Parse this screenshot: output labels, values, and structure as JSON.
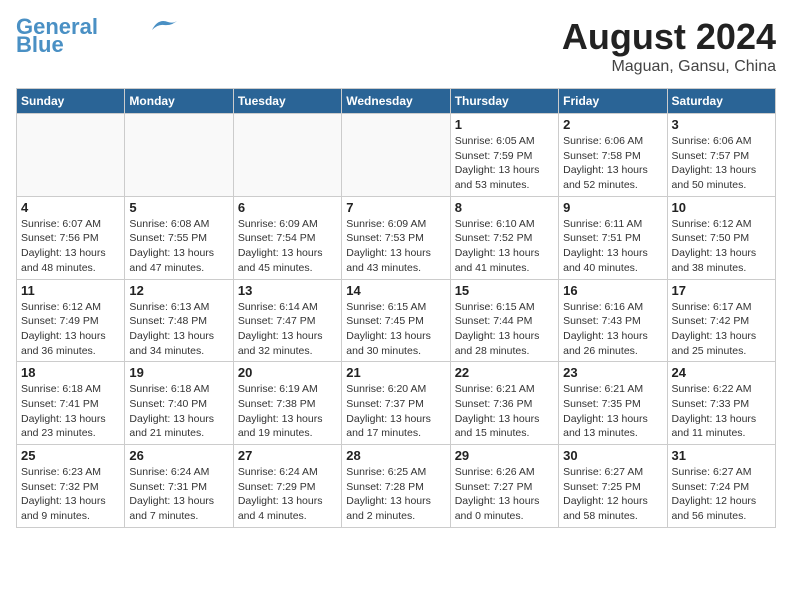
{
  "header": {
    "logo_line1": "General",
    "logo_line2": "Blue",
    "month_year": "August 2024",
    "location": "Maguan, Gansu, China"
  },
  "days_of_week": [
    "Sunday",
    "Monday",
    "Tuesday",
    "Wednesday",
    "Thursday",
    "Friday",
    "Saturday"
  ],
  "weeks": [
    [
      {
        "day": "",
        "info": ""
      },
      {
        "day": "",
        "info": ""
      },
      {
        "day": "",
        "info": ""
      },
      {
        "day": "",
        "info": ""
      },
      {
        "day": "1",
        "info": "Sunrise: 6:05 AM\nSunset: 7:59 PM\nDaylight: 13 hours\nand 53 minutes."
      },
      {
        "day": "2",
        "info": "Sunrise: 6:06 AM\nSunset: 7:58 PM\nDaylight: 13 hours\nand 52 minutes."
      },
      {
        "day": "3",
        "info": "Sunrise: 6:06 AM\nSunset: 7:57 PM\nDaylight: 13 hours\nand 50 minutes."
      }
    ],
    [
      {
        "day": "4",
        "info": "Sunrise: 6:07 AM\nSunset: 7:56 PM\nDaylight: 13 hours\nand 48 minutes."
      },
      {
        "day": "5",
        "info": "Sunrise: 6:08 AM\nSunset: 7:55 PM\nDaylight: 13 hours\nand 47 minutes."
      },
      {
        "day": "6",
        "info": "Sunrise: 6:09 AM\nSunset: 7:54 PM\nDaylight: 13 hours\nand 45 minutes."
      },
      {
        "day": "7",
        "info": "Sunrise: 6:09 AM\nSunset: 7:53 PM\nDaylight: 13 hours\nand 43 minutes."
      },
      {
        "day": "8",
        "info": "Sunrise: 6:10 AM\nSunset: 7:52 PM\nDaylight: 13 hours\nand 41 minutes."
      },
      {
        "day": "9",
        "info": "Sunrise: 6:11 AM\nSunset: 7:51 PM\nDaylight: 13 hours\nand 40 minutes."
      },
      {
        "day": "10",
        "info": "Sunrise: 6:12 AM\nSunset: 7:50 PM\nDaylight: 13 hours\nand 38 minutes."
      }
    ],
    [
      {
        "day": "11",
        "info": "Sunrise: 6:12 AM\nSunset: 7:49 PM\nDaylight: 13 hours\nand 36 minutes."
      },
      {
        "day": "12",
        "info": "Sunrise: 6:13 AM\nSunset: 7:48 PM\nDaylight: 13 hours\nand 34 minutes."
      },
      {
        "day": "13",
        "info": "Sunrise: 6:14 AM\nSunset: 7:47 PM\nDaylight: 13 hours\nand 32 minutes."
      },
      {
        "day": "14",
        "info": "Sunrise: 6:15 AM\nSunset: 7:45 PM\nDaylight: 13 hours\nand 30 minutes."
      },
      {
        "day": "15",
        "info": "Sunrise: 6:15 AM\nSunset: 7:44 PM\nDaylight: 13 hours\nand 28 minutes."
      },
      {
        "day": "16",
        "info": "Sunrise: 6:16 AM\nSunset: 7:43 PM\nDaylight: 13 hours\nand 26 minutes."
      },
      {
        "day": "17",
        "info": "Sunrise: 6:17 AM\nSunset: 7:42 PM\nDaylight: 13 hours\nand 25 minutes."
      }
    ],
    [
      {
        "day": "18",
        "info": "Sunrise: 6:18 AM\nSunset: 7:41 PM\nDaylight: 13 hours\nand 23 minutes."
      },
      {
        "day": "19",
        "info": "Sunrise: 6:18 AM\nSunset: 7:40 PM\nDaylight: 13 hours\nand 21 minutes."
      },
      {
        "day": "20",
        "info": "Sunrise: 6:19 AM\nSunset: 7:38 PM\nDaylight: 13 hours\nand 19 minutes."
      },
      {
        "day": "21",
        "info": "Sunrise: 6:20 AM\nSunset: 7:37 PM\nDaylight: 13 hours\nand 17 minutes."
      },
      {
        "day": "22",
        "info": "Sunrise: 6:21 AM\nSunset: 7:36 PM\nDaylight: 13 hours\nand 15 minutes."
      },
      {
        "day": "23",
        "info": "Sunrise: 6:21 AM\nSunset: 7:35 PM\nDaylight: 13 hours\nand 13 minutes."
      },
      {
        "day": "24",
        "info": "Sunrise: 6:22 AM\nSunset: 7:33 PM\nDaylight: 13 hours\nand 11 minutes."
      }
    ],
    [
      {
        "day": "25",
        "info": "Sunrise: 6:23 AM\nSunset: 7:32 PM\nDaylight: 13 hours\nand 9 minutes."
      },
      {
        "day": "26",
        "info": "Sunrise: 6:24 AM\nSunset: 7:31 PM\nDaylight: 13 hours\nand 7 minutes."
      },
      {
        "day": "27",
        "info": "Sunrise: 6:24 AM\nSunset: 7:29 PM\nDaylight: 13 hours\nand 4 minutes."
      },
      {
        "day": "28",
        "info": "Sunrise: 6:25 AM\nSunset: 7:28 PM\nDaylight: 13 hours\nand 2 minutes."
      },
      {
        "day": "29",
        "info": "Sunrise: 6:26 AM\nSunset: 7:27 PM\nDaylight: 13 hours\nand 0 minutes."
      },
      {
        "day": "30",
        "info": "Sunrise: 6:27 AM\nSunset: 7:25 PM\nDaylight: 12 hours\nand 58 minutes."
      },
      {
        "day": "31",
        "info": "Sunrise: 6:27 AM\nSunset: 7:24 PM\nDaylight: 12 hours\nand 56 minutes."
      }
    ]
  ]
}
